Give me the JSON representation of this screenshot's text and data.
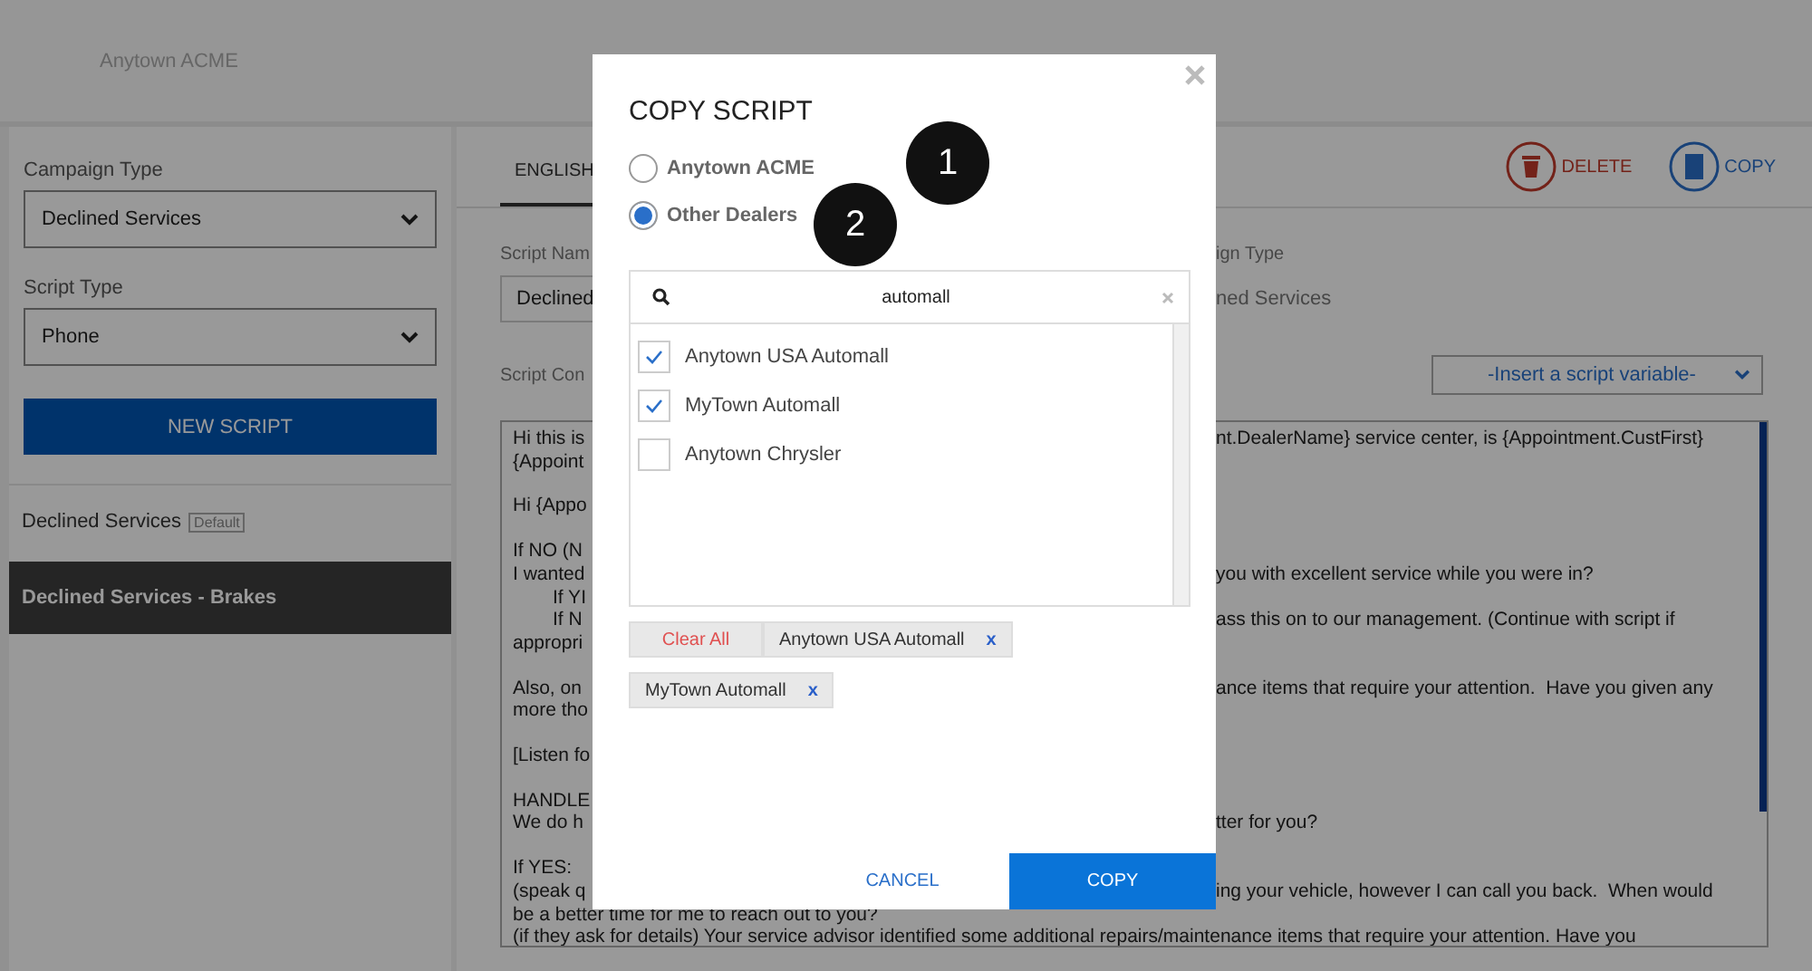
{
  "header": {
    "title": "Anytown ACME"
  },
  "sidebar": {
    "fields": [
      {
        "label": "Campaign Type",
        "value": "Declined Services"
      },
      {
        "label": "Script Type",
        "value": "Phone"
      }
    ],
    "button": "NEW SCRIPT",
    "scripts": [
      {
        "name": "Declined Services",
        "badge": "Default",
        "selected": false
      },
      {
        "name": "Declined Services - Brakes",
        "selected": true
      }
    ]
  },
  "main": {
    "tabs": [
      {
        "label": "ENGLISH",
        "selected": true
      }
    ],
    "actions": [
      {
        "kind": "delete",
        "label": "DELETE"
      },
      {
        "kind": "copy",
        "label": "COPY"
      }
    ],
    "script_name": {
      "label": "Script Nam",
      "value": "Declined"
    },
    "campaign_type": {
      "label": "ign Type",
      "value": "ned Services"
    },
    "content_label": "Script Con",
    "variable_select": "-Insert a script variable-",
    "script_paragraphs": [
      [
        {
          "left": "Hi this is",
          "right": "nt.DealerName} service center, is {Appointment.CustFirst}"
        },
        {
          "left": "{Appoint"
        }
      ],
      [
        {
          "left": "Hi {Appo"
        }
      ],
      [
        {
          "left": "If NO (N"
        },
        {
          "left": "I wanted",
          "right": "you with excellent service while you were in?"
        },
        {
          "left": "If YI",
          "indented": true
        },
        {
          "left": "If N",
          "indented": true,
          "right": "ass this on to our management. (Continue with script if"
        },
        {
          "left": "appropri"
        }
      ],
      [
        {
          "left": "Also, on",
          "right": "ance items that require your attention.  Have you given any"
        },
        {
          "left": "more tho"
        }
      ],
      [
        {
          "left": "[Listen fo"
        }
      ],
      [
        {
          "left": "HANDLE"
        },
        {
          "left": "We do h",
          "right": "tter for you?"
        }
      ],
      [
        {
          "left": "If YES:"
        },
        {
          "left": "(speak q",
          "right": "ing your vehicle, however I can call you back.  When would"
        },
        {
          "full": "be a better time for me to reach out to you?"
        },
        {
          "full": "(if they ask for details) Your service advisor identified some additional repairs/maintenance items that require your attention.  Have you"
        }
      ]
    ]
  },
  "dialog": {
    "title": "COPY SCRIPT",
    "options": [
      {
        "label": "Anytown ACME",
        "selected": false
      },
      {
        "label": "Other Dealers",
        "selected": true
      }
    ],
    "callouts": [
      {
        "number": "1"
      },
      {
        "number": "2"
      }
    ],
    "search": {
      "value": "automall"
    },
    "dealers": [
      {
        "name": "Anytown USA Automall",
        "checked": true
      },
      {
        "name": "MyTown Automall",
        "checked": true
      },
      {
        "name": "Anytown Chrysler",
        "checked": false
      }
    ],
    "clear_all": "Clear All",
    "chips": [
      {
        "label": "Anytown USA Automall",
        "remove": "x"
      },
      {
        "label": "MyTown Automall",
        "remove": "x"
      }
    ],
    "cancel": "CANCEL",
    "confirm": "COPY"
  }
}
